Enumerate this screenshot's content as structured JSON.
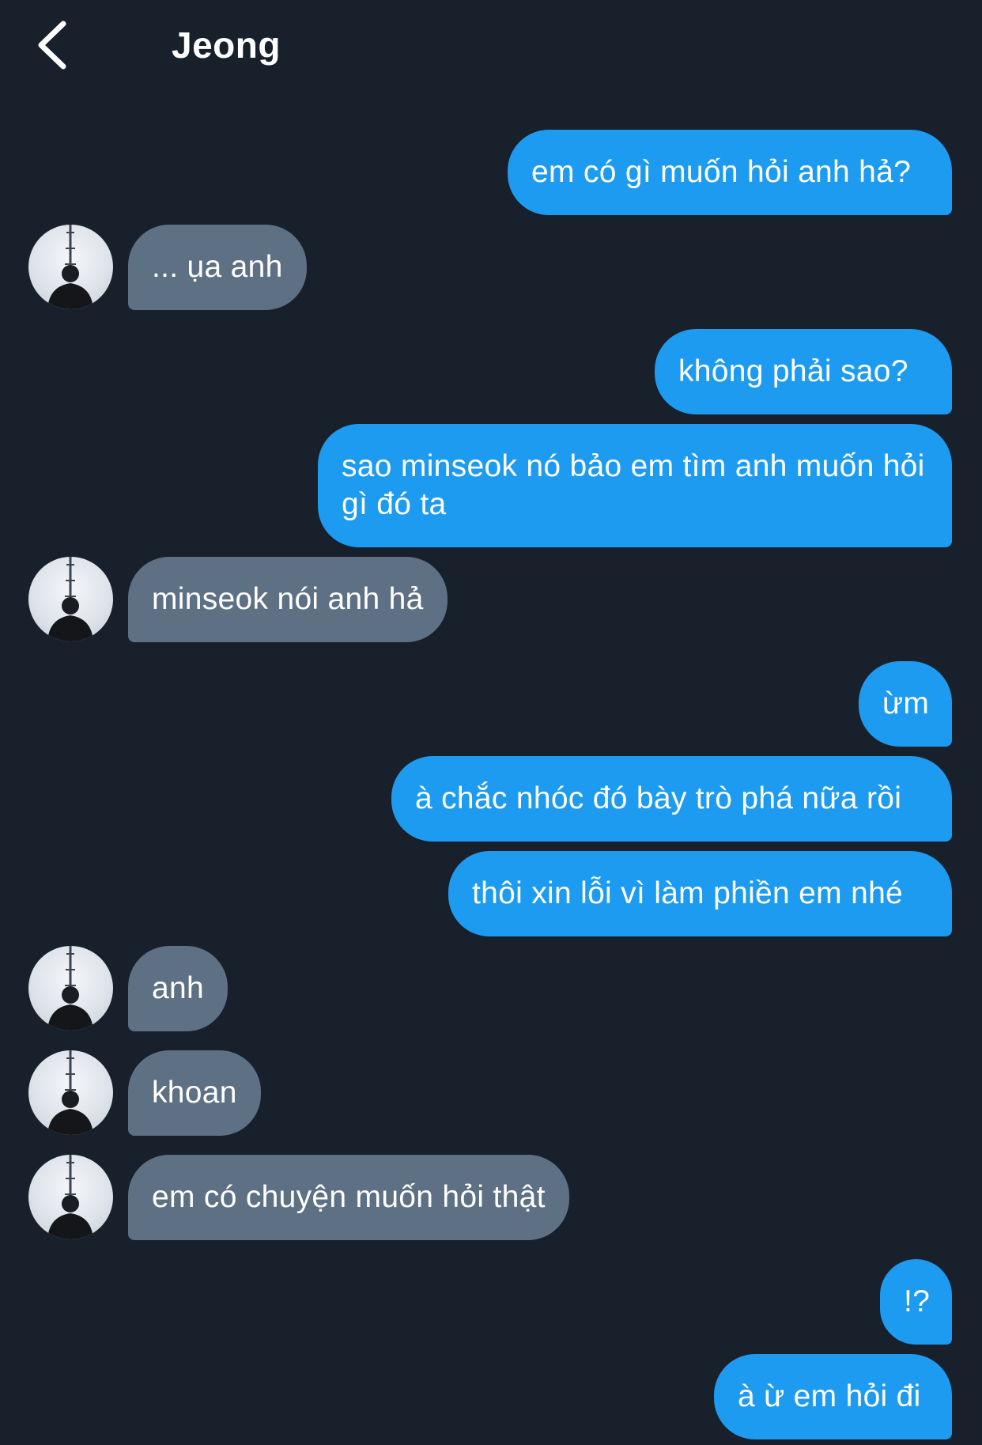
{
  "header": {
    "back_icon": "chevron-left-icon",
    "title": "Jeong"
  },
  "colors": {
    "background": "#17202b",
    "outgoing_bubble": "#1d9bf0",
    "incoming_bubble": "#5e7083",
    "text": "#ffffff"
  },
  "messages": [
    {
      "direction": "out",
      "text": "em có gì muốn hỏi anh hả?"
    },
    {
      "direction": "in",
      "text": "... ụa anh"
    },
    {
      "direction": "out",
      "text": "không phải sao?"
    },
    {
      "direction": "out",
      "text": "sao minseok nó bảo em tìm anh muốn hỏi gì đó ta"
    },
    {
      "direction": "in",
      "text": "minseok nói anh hả"
    },
    {
      "direction": "out",
      "text": "ừm"
    },
    {
      "direction": "out",
      "text": "à chắc nhóc đó bày trò phá nữa rồi"
    },
    {
      "direction": "out",
      "text": "thôi xin lỗi vì làm phiền em nhé"
    },
    {
      "direction": "in",
      "text": "anh"
    },
    {
      "direction": "in",
      "text": "khoan"
    },
    {
      "direction": "in",
      "text": "em có chuyện muốn hỏi thật"
    },
    {
      "direction": "out",
      "text": "!?"
    },
    {
      "direction": "out",
      "text": "à ừ em hỏi đi"
    }
  ]
}
